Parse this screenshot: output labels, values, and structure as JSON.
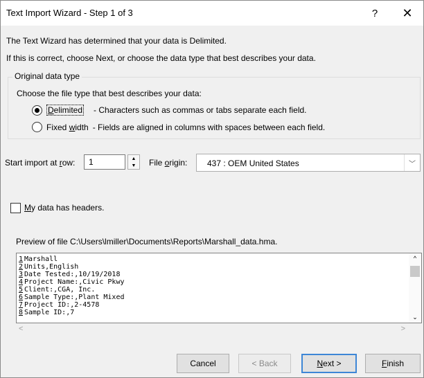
{
  "window": {
    "title": "Text Import Wizard - Step 1 of 3",
    "help": "?",
    "close": "✕"
  },
  "intro": {
    "line1": "The Text Wizard has determined that your data is Delimited.",
    "line2": "If this is correct, choose Next, or choose the data type that best describes your data."
  },
  "data_type": {
    "group_label": "Original data type",
    "prompt": "Choose the file type that best describes your data:",
    "options": [
      {
        "label": "Delimited",
        "accel": "D",
        "rest": "elimited",
        "desc": "- Characters such as commas or tabs separate each field.",
        "selected": true
      },
      {
        "label": "Fixed width",
        "accel_pre": "Fixed ",
        "accel": "w",
        "rest": "idth",
        "desc": "- Fields are aligned in columns with spaces between each field.",
        "selected": false
      }
    ]
  },
  "start_row": {
    "label_pre": "Start import at ",
    "accel": "r",
    "label_post": "ow:",
    "value": "1"
  },
  "file_origin": {
    "label_pre": "File ",
    "accel": "o",
    "label_post": "rigin:",
    "value": "437 : OEM United States"
  },
  "headers": {
    "accel": "M",
    "label_post": "y data has headers.",
    "checked": false
  },
  "preview": {
    "label": "Preview of file C:\\Users\\lmiller\\Documents\\Reports\\Marshall_data.hma.",
    "lines": [
      {
        "num": "1",
        "text": "Marshall"
      },
      {
        "num": "2",
        "text": "Units,English"
      },
      {
        "num": "3",
        "text": "Date Tested:,10/19/2018"
      },
      {
        "num": "4",
        "text": "Project Name:,Civic Pkwy"
      },
      {
        "num": "5",
        "text": "Client:,CGA, Inc."
      },
      {
        "num": "6",
        "text": "Sample Type:,Plant Mixed"
      },
      {
        "num": "7",
        "text": "Project ID:,2-4578"
      },
      {
        "num": "8",
        "text": "Sample ID:,7"
      }
    ]
  },
  "buttons": {
    "cancel": "Cancel",
    "back": "< Back",
    "next_accel": "N",
    "next_rest": "ext >",
    "finish_accel": "F",
    "finish_rest": "inish"
  }
}
